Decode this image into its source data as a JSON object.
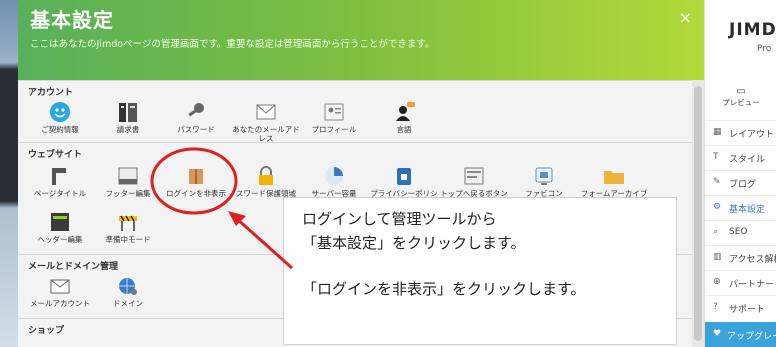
{
  "dialog": {
    "title": "基本設定",
    "subtitle": "ここはあなたのJimdoページの管理画面です。重要な設定は管理画面から行うことができます。",
    "close_label": "×"
  },
  "sections": {
    "account": {
      "title": "アカウント",
      "items": [
        {
          "label": "ご契約情報",
          "icon": "contract-icon"
        },
        {
          "label": "請求書",
          "icon": "invoice-icon"
        },
        {
          "label": "パスワード",
          "icon": "key-icon"
        },
        {
          "label": "あなたのメールアドレス",
          "icon": "email-address-icon"
        },
        {
          "label": "プロフィール",
          "icon": "profile-icon"
        },
        {
          "label": "言語",
          "icon": "language-icon"
        }
      ]
    },
    "website": {
      "title": "ウェブサイト",
      "items": [
        {
          "label": "ページタイトル",
          "icon": "page-title-icon"
        },
        {
          "label": "フッター編集",
          "icon": "footer-icon"
        },
        {
          "label": "ログインを非表示",
          "icon": "hide-login-icon"
        },
        {
          "label": "スワード保護領域",
          "icon": "lock-icon"
        },
        {
          "label": "サーバー容量",
          "icon": "pie-icon"
        },
        {
          "label": "プライバシーポリシー",
          "icon": "privacy-icon"
        },
        {
          "label": "トップへ戻るボタン",
          "icon": "back-to-top-icon"
        },
        {
          "label": "ファビコン",
          "icon": "favicon-icon"
        },
        {
          "label": "フォームアーカイブ",
          "icon": "folder-icon"
        },
        {
          "label": "ヘッダー編集",
          "icon": "header-edit-icon"
        },
        {
          "label": "準備中モード",
          "icon": "maintenance-icon"
        }
      ]
    },
    "mail_domain": {
      "title": "メールとドメイン管理",
      "items": [
        {
          "label": "メールアカウント",
          "icon": "mail-icon"
        },
        {
          "label": "ドメイン",
          "icon": "domain-icon"
        }
      ]
    },
    "shop": {
      "title": "ショップ"
    }
  },
  "sidebar": {
    "brand": "JIMD",
    "plan": "Pro",
    "preview_label": "プレビュー",
    "items": [
      {
        "label": "レイアウト",
        "icon": "▦"
      },
      {
        "label": "スタイル",
        "icon": "T"
      },
      {
        "label": "ブログ",
        "icon": "✎"
      },
      {
        "label": "基本設定",
        "icon": "⚙"
      },
      {
        "label": "SEO",
        "icon": "⌕"
      },
      {
        "label": "アクセス解析",
        "icon": "▥"
      },
      {
        "label": "パートナー",
        "icon": "⊕"
      },
      {
        "label": "サポート",
        "icon": "?"
      }
    ],
    "upgrade_label": "アップグレー"
  },
  "annotation": {
    "line1": "ログインして管理ツールから",
    "line2": "「基本設定」をクリックします。",
    "line3": "「ログインを非表示」をクリックします。",
    "color": "#e02020"
  }
}
